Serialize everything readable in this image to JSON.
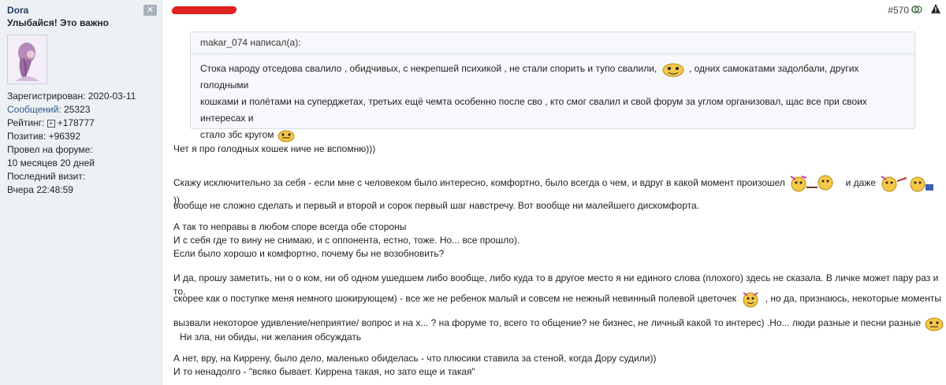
{
  "user": {
    "name": "Dora",
    "title": "Улыбайся! Это важно",
    "close_icon": "x-icon",
    "stats": {
      "registered_label": "Зарегистрирован:",
      "registered_value": "2020-03-11",
      "messages_label": "Сообщений:",
      "messages_value": "25323",
      "rating_label": "Рейтинг:",
      "rating_plus": "+",
      "rating_value": "+178777",
      "positive_label": "Позитив:",
      "positive_value": "+96392",
      "forum_time_label": "Провел на форуме:",
      "forum_time_value": "10 месяцев 20 дней",
      "last_visit_label": "Последний визит:",
      "last_visit_value": "Вчера 22:48:59"
    }
  },
  "post": {
    "number": "#570",
    "icons": [
      "copy-link-icon",
      "warning-icon"
    ],
    "quote": {
      "header": "makar_074 написал(а):",
      "line1": "Стока народу отседова свалило , обидчивых, с некрепшей психикой , не стали спорить и тупо свалили,",
      "line1b": ", одних самокатами задолбали, других голодными",
      "line2": "кошками и полётами на суперджетах, третьих ещё чемта особенно после сво , кто смог свалил и свой форум за углом организовал, щас все при своих интересах и",
      "line3": "стало збс кругом"
    },
    "p1": "Чет я про голодных кошек ниче не вспомню)))",
    "p2a": "Скажу исключительно за себя - если мне с человеком было интересно, комфортно, было всегда о чем, и вдруг в какой момент произошел",
    "p2b": "и даже",
    "p2c": "))",
    "p2d": "вообще не сложно сделать и первый и второй и сорок первый шаг навстречу. Вот вообще ни малейшего дискомфорта.",
    "p3a": "А так то неправы в любом споре всегда обе стороны",
    "p3b": "И с себя где то вину не снимаю, и с оппонента, естно, тоже. Но... все прошло).",
    "p3c": "Если было хорошо и комфортно, почему бы не возобновить?",
    "p4a": "И да, прошу заметить, ни о о ком, ни об одном ушедшем либо вообще, либо куда то в другое место я ни единого слова (плохого) здесь не сказала. В личке может пару раз и то,",
    "p4b": "скорее как о поступке меня немного шокирующем) - все же не ребенок малый и совсем не нежный невинный полевой цветочек",
    "p4c": ", но да, признаюсь, некоторые моменты",
    "p4d": "вызвали некоторое удивление/неприятие/ вопрос и на х... ? на форуме то, всего то общение? не бизнес, не личный какой то интерес) .Но... люди разные и песни разные",
    "p4e": "Ни зла, ни обиды, ни желания обсуждать",
    "p5a": "А нет, вру, на Киррену, было дело, маленько обиделась - что плюсики ставила за стеной, когда Дору судили))",
    "p5b": "И то ненадолго - \"всяко бывает. Киррена такая, но зато еще и такая\""
  },
  "colors": {
    "sidebar_bg": "#eef1f4",
    "link": "#2a568a",
    "quote_bg": "#f6f8fb",
    "redaction": "#e02121"
  }
}
